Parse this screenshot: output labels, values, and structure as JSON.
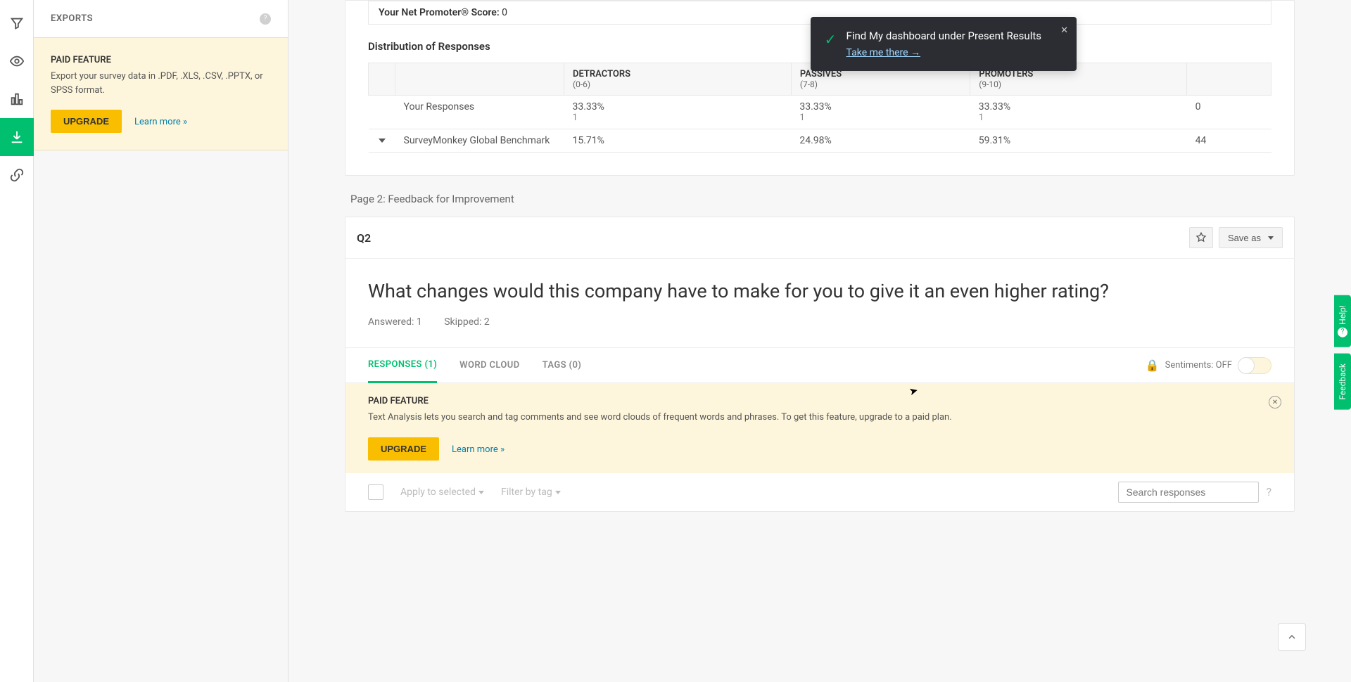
{
  "sidebar": {
    "title": "EXPORTS",
    "paid_box": {
      "label": "PAID FEATURE",
      "desc": "Export your survey data in .PDF, .XLS, .CSV, .PPTX, or SPSS format.",
      "upgrade": "UPGRADE",
      "learn_more": "Learn more »"
    }
  },
  "toast": {
    "message": "Find My dashboard under Present Results",
    "link": "Take me there →"
  },
  "nps": {
    "score_label": "Your Net Promoter® Score:",
    "score_value": "0",
    "dist_title": "Distribution of Responses",
    "headers": {
      "detractors_title": "DETRACTORS",
      "detractors_sub": "(0-6)",
      "passives_title": "PASSIVES",
      "passives_sub": "(7-8)",
      "promoters_title": "PROMOTERS",
      "promoters_sub": "(9-10)",
      "last": ""
    },
    "rows": [
      {
        "label": "Your Responses",
        "detractors_pct": "33.33%",
        "detractors_n": "1",
        "passives_pct": "33.33%",
        "passives_n": "1",
        "promoters_pct": "33.33%",
        "promoters_n": "1",
        "last": "0",
        "has_caret": false
      },
      {
        "label": "SurveyMonkey Global Benchmark",
        "detractors_pct": "15.71%",
        "detractors_n": "",
        "passives_pct": "24.98%",
        "passives_n": "",
        "promoters_pct": "59.31%",
        "promoters_n": "",
        "last": "44",
        "has_caret": true
      }
    ]
  },
  "page_heading": "Page 2: Feedback for Improvement",
  "q2": {
    "num": "Q2",
    "save_as": "Save as",
    "title": "What changes would this company have to make for you to give it an even higher rating?",
    "answered": "Answered: 1",
    "skipped": "Skipped: 2",
    "tabs": {
      "responses": "RESPONSES (1)",
      "wordcloud": "WORD CLOUD",
      "tags": "TAGS (0)"
    },
    "sentiments_label": "Sentiments: OFF",
    "paid_banner": {
      "label": "PAID FEATURE",
      "desc": "Text Analysis lets you search and tag comments and see word clouds of frequent words and phrases. To get this feature, upgrade to a paid plan.",
      "upgrade": "UPGRADE",
      "learn_more": "Learn more »"
    },
    "filters": {
      "apply": "Apply to selected",
      "filter_tag": "Filter by tag",
      "search_placeholder": "Search responses"
    }
  },
  "right_tabs": {
    "help": "Help!",
    "feedback": "Feedback"
  }
}
